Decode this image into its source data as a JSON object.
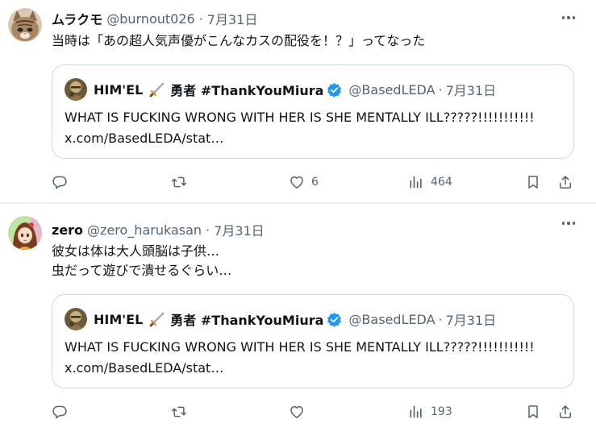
{
  "posts": [
    {
      "author_name": "ムラクモ",
      "author_handle": "@burnout026",
      "separator": "·",
      "date": "7月31日",
      "lines": [
        "当時は「あの超人気声優がこんなカスの配役を！？」ってなった"
      ],
      "quote": {
        "name": "HIM'EL",
        "name_suffix": "勇者 #ThankYouMiura",
        "handle": "@BasedLEDA",
        "separator": "·",
        "date": "7月31日",
        "text_line1": "WHAT IS FUCKING WRONG WITH HER IS SHE MENTALLY ILL?????!!!!!!!!!!!",
        "text_line2": "x.com/BasedLEDA/stat…"
      },
      "actions": {
        "reply_count": "",
        "repost_count": "",
        "like_count": "6",
        "views_count": "464"
      }
    },
    {
      "author_name": "zero",
      "author_handle": "@zero_harukasan",
      "separator": "·",
      "date": "7月31日",
      "lines": [
        "彼女は体は大人頭脳は子供…",
        "虫だって遊びで潰せるぐらい…"
      ],
      "quote": {
        "name": "HIM'EL",
        "name_suffix": "勇者 #ThankYouMiura",
        "handle": "@BasedLEDA",
        "separator": "·",
        "date": "7月31日",
        "text_line1": "WHAT IS FUCKING WRONG WITH HER IS SHE MENTALLY ILL?????!!!!!!!!!!!",
        "text_line2": "x.com/BasedLEDA/stat…"
      },
      "actions": {
        "reply_count": "",
        "repost_count": "",
        "like_count": "",
        "views_count": "193"
      }
    }
  ],
  "icons": {
    "reply": "reply-icon",
    "repost": "repost-icon",
    "like": "heart-icon",
    "views": "views-chart-icon",
    "bookmark": "bookmark-icon",
    "share": "share-icon",
    "more": "more-options-icon",
    "verified": "verified-badge-icon",
    "sword": "dagger-emoji-icon"
  },
  "colors": {
    "text": "#0f1419",
    "secondary": "#536471",
    "verified": "#1d9bf0",
    "border": "#cfd9de"
  }
}
